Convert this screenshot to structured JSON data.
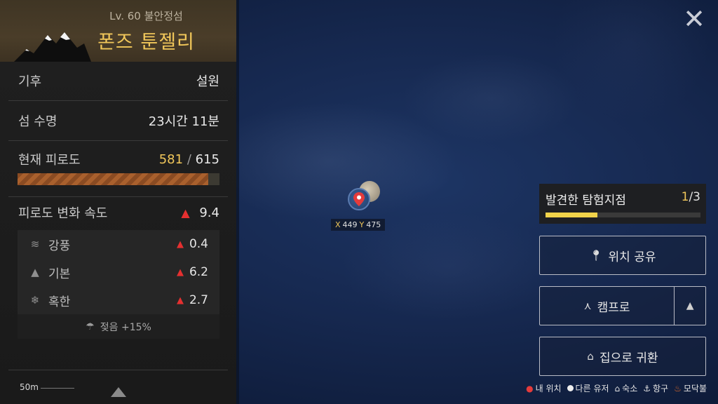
{
  "island": {
    "level": "Lv. 60 불안정섬",
    "name": "폰즈 툰젤리"
  },
  "stats": {
    "climate_label": "기후",
    "climate_value": "설원",
    "lifetime_label": "섬 수명",
    "lifetime_value": "23시간 11분",
    "fatigue_label": "현재 피로도",
    "fatigue_current": "581",
    "fatigue_sep": "/",
    "fatigue_max": "615",
    "fatigue_fraction": 0.945,
    "rate_label": "피로도 변화 속도",
    "rate_value": "9.4"
  },
  "factors": [
    {
      "icon": "wind-icon",
      "label": "강풍",
      "value": "0.4"
    },
    {
      "icon": "mountain-icon",
      "label": "기본",
      "value": "6.2"
    },
    {
      "icon": "snowflake-icon",
      "label": "혹한",
      "value": "2.7"
    }
  ],
  "wet": {
    "icon": "wet-icon",
    "label": "젖음 +15%"
  },
  "scale": {
    "label": "50m"
  },
  "coords": {
    "x_label": "X",
    "x_value": "449",
    "y_label": "Y",
    "y_value": "475"
  },
  "explore": {
    "title": "발견한 탐험지점",
    "current": "1",
    "total": "/3",
    "progress": 0.333
  },
  "buttons": {
    "share_location": "위치 공유",
    "campfire": "캠프로",
    "return_home": "집으로 귀환"
  },
  "legend": {
    "my_location": "내 위치",
    "other_users": "다른 유저",
    "lodging": "숙소",
    "harbor": "항구",
    "bonfire": "모닥불"
  },
  "colors": {
    "accent": "#f1c75a",
    "rate_up": "#e53030",
    "progress": "#f1d34a",
    "map_bg": "#16284f"
  }
}
